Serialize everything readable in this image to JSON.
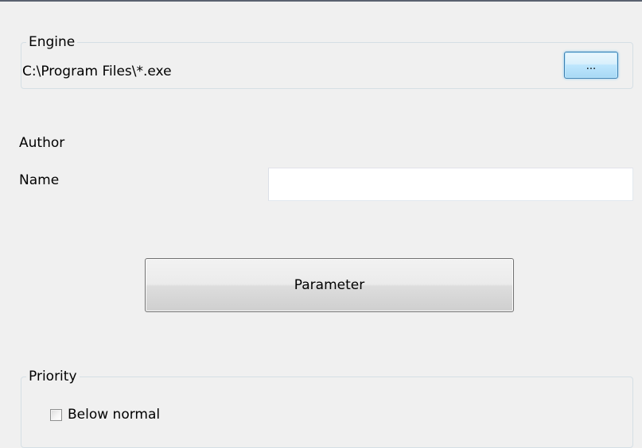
{
  "engine": {
    "legend": "Engine",
    "path": "C:\\Program Files\\*.exe",
    "browse_label": "..."
  },
  "author": {
    "section_label": "Author",
    "name_label": "Name",
    "name_value": "",
    "name_placeholder": ""
  },
  "parameter_button_label": "Parameter",
  "priority": {
    "legend": "Priority",
    "below_normal_label": "Below normal",
    "below_normal_checked": false
  }
}
